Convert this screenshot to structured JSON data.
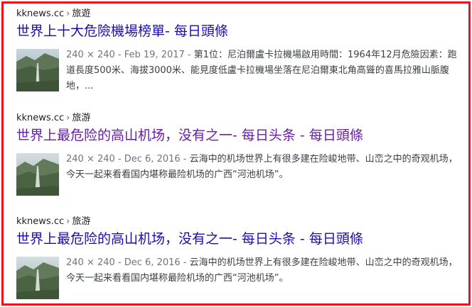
{
  "results": [
    {
      "site": "kknews.cc",
      "separator": "›",
      "section": "旅遊",
      "title": "世界上十大危險機場榜單- 每日頭條",
      "meta": "240 × 240 - Feb 19, 2017 - ",
      "snippet": "第1位：尼泊爾盧卡拉機場啟用時間：1964年12月危險因素：跑道長度500米、海拔3000米、能見度低盧卡拉機場坐落在尼泊爾東北角高聳的喜馬拉雅山脈腹地，..."
    },
    {
      "site": "kknews.cc",
      "separator": "›",
      "section": "旅游",
      "title": "世界上最危险的高山机场，没有之一- 每日头条 - 每日頭條",
      "meta": "240 × 240 - Dec 6, 2016 - ",
      "snippet": "云海中的机场世界上有很多建在险峻地带、山峦之中的奇观机场，今天一起来看看国内堪称最险机场的广西“河池机场”。"
    },
    {
      "site": "kknews.cc",
      "separator": "›",
      "section": "旅游",
      "title": "世界上最危险的高山机场，没有之一- 每日头条 - 每日頭條",
      "meta": "240 × 240 - Dec 6, 2016 - ",
      "snippet": "云海中的机场世界上有很多建在险峻地带、山峦之中的奇观机场，今天一起来看看国内堪称最险机场的广西“河池机场”。"
    }
  ]
}
